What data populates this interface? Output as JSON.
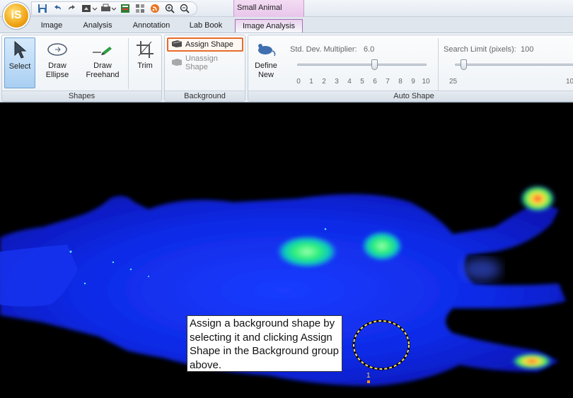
{
  "app": {
    "logo_text": "iS"
  },
  "context_tab_group": "Small Animal",
  "tabs": [
    {
      "label": "Image"
    },
    {
      "label": "Analysis"
    },
    {
      "label": "Annotation"
    },
    {
      "label": "Lab Book"
    },
    {
      "label": "Image Analysis",
      "active": true
    }
  ],
  "quick_access_icons": [
    "save-icon",
    "undo-icon",
    "redo-icon",
    "export-icon",
    "print-icon",
    "report-icon",
    "grid-icon",
    "rss-icon",
    "zoom-in-icon",
    "zoom-out-icon"
  ],
  "ribbon": {
    "shapes": {
      "label": "Shapes",
      "select": "Select",
      "draw_ellipse": "Draw\nEllipse",
      "draw_freehand": "Draw\nFreehand",
      "trim": "Trim"
    },
    "background": {
      "label": "Background",
      "assign_shape": "Assign Shape",
      "unassign_shape": "Unassign Shape"
    },
    "auto_shape": {
      "label": "Auto Shape",
      "define_new": "Define\nNew",
      "std_dev_label": "Std. Dev. Multiplier:",
      "std_dev_value": "6.0",
      "std_dev_ticks": [
        "0",
        "1",
        "2",
        "3",
        "4",
        "5",
        "6",
        "7",
        "8",
        "9",
        "10"
      ],
      "search_limit_label": "Search Limit (pixels):",
      "search_limit_value": "100",
      "search_limit_min": "25",
      "search_limit_max": "10"
    }
  },
  "viewer": {
    "tooltip": "Assign a background shape by selecting it and clicking Assign Shape in the Background group above.",
    "roi_label": "1"
  },
  "colors": {
    "accent_highlight": "#e86a2a",
    "context_tab": "#e8c6ea",
    "roi": "#ffe066"
  }
}
